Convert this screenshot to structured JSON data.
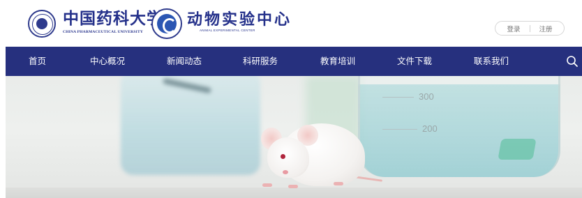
{
  "header": {
    "university_name_cn": "中国药科大学",
    "university_name_en": "CHINA PHARMACEUTICAL UNIVERSITY",
    "center_name_cn": "动物实验中心",
    "center_name_en": "ANIMAL EXPERIMENTAL CENTER",
    "auth": {
      "login_label": "登录",
      "register_label": "注册"
    }
  },
  "nav": {
    "items": [
      {
        "label": "首页"
      },
      {
        "label": "中心概况"
      },
      {
        "label": "新闻动态"
      },
      {
        "label": "科研服务"
      },
      {
        "label": "教育培训"
      },
      {
        "label": "文件下载"
      },
      {
        "label": "联系我们"
      }
    ],
    "search_icon": "search-icon"
  },
  "banner": {
    "flask_mark_300": "300",
    "flask_mark_200": "200"
  },
  "colors": {
    "nav_background": "#26307e",
    "brand_blue": "#24308a",
    "nav_text": "#ffffff"
  }
}
